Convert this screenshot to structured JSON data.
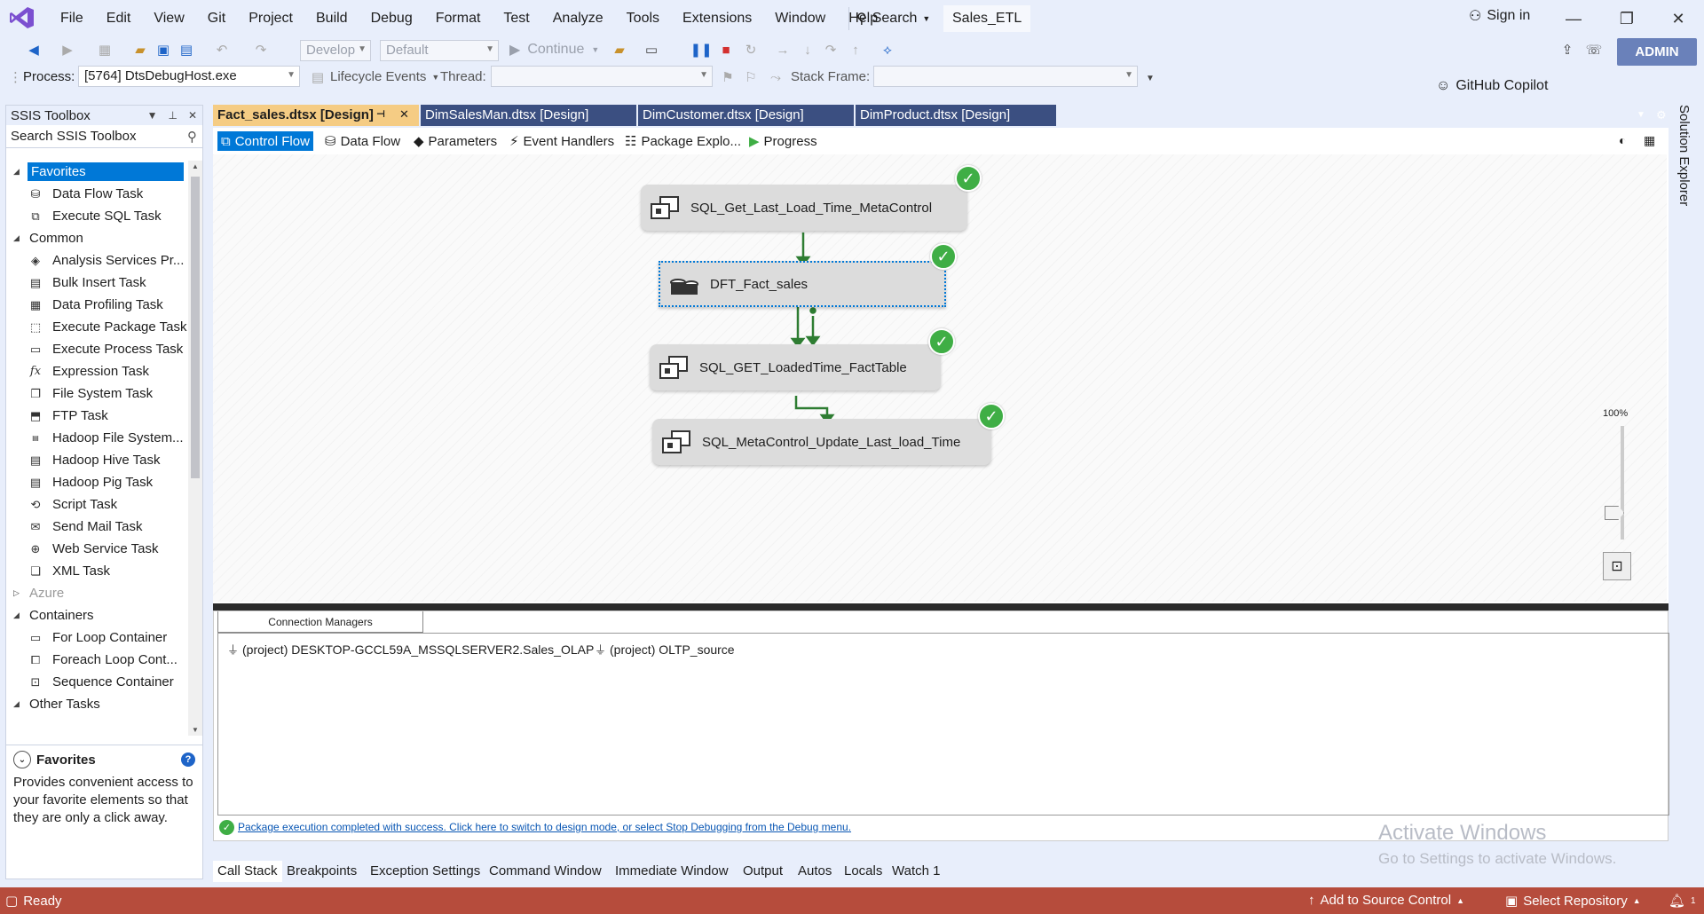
{
  "menubar": {
    "items": [
      "File",
      "Edit",
      "View",
      "Git",
      "Project",
      "Build",
      "Debug",
      "Format",
      "Test",
      "Analyze",
      "Tools",
      "Extensions",
      "Window",
      "Help"
    ],
    "search_label": "Search",
    "solution_name": "Sales_ETL",
    "sign_in": "Sign in"
  },
  "toolbar1": {
    "config_combo": "Develop",
    "platform_combo": "Default",
    "continue_label": "Continue",
    "copilot_label": "GitHub Copilot",
    "admin_label": "ADMIN"
  },
  "toolbar2": {
    "process_label": "Process:",
    "process_value": "[5764] DtsDebugHost.exe",
    "lifecycle_label": "Lifecycle Events",
    "thread_label": "Thread:",
    "stack_frame_label": "Stack Frame:"
  },
  "toolbox": {
    "title": "SSIS Toolbox",
    "search_placeholder": "Search SSIS Toolbox",
    "favorites_label": "Favorites",
    "favorites": [
      "Data Flow Task",
      "Execute SQL Task"
    ],
    "common_label": "Common",
    "common": [
      "Analysis Services Pr...",
      "Bulk Insert Task",
      "Data Profiling Task",
      "Execute Package Task",
      "Execute Process Task",
      "Expression Task",
      "File System Task",
      "FTP Task",
      "Hadoop File System...",
      "Hadoop Hive Task",
      "Hadoop Pig Task",
      "Script Task",
      "Send Mail Task",
      "Web Service Task",
      "XML Task"
    ],
    "azure_label": "Azure",
    "containers_label": "Containers",
    "containers": [
      "For Loop Container",
      "Foreach Loop Cont...",
      "Sequence Container"
    ],
    "other_label": "Other Tasks",
    "desc_title": "Favorites",
    "desc_text": "Provides convenient access to your favorite elements so that they are only a click away."
  },
  "doc_tabs": [
    {
      "label": "Fact_sales.dtsx [Design]",
      "active": true
    },
    {
      "label": "DimSalesMan.dtsx [Design]",
      "active": false
    },
    {
      "label": "DimCustomer.dtsx [Design]",
      "active": false
    },
    {
      "label": "DimProduct.dtsx [Design]",
      "active": false
    }
  ],
  "designer_tabs": [
    "Control Flow",
    "Data Flow",
    "Parameters",
    "Event Handlers",
    "Package Explo...",
    "Progress"
  ],
  "tasks": [
    {
      "name": "SQL_Get_Last_Load_Time_MetaControl",
      "status": "success"
    },
    {
      "name": "DFT_Fact_sales",
      "status": "success"
    },
    {
      "name": "SQL_GET_LoadedTime_FactTable",
      "status": "success"
    },
    {
      "name": "SQL_MetaControl_Update_Last_load_Time",
      "status": "success"
    }
  ],
  "zoom_label": "100%",
  "connection_managers": {
    "tab_label": "Connection Managers",
    "items": [
      "(project) DESKTOP-GCCL59A_MSSQLSERVER2.Sales_OLAP",
      "(project) OLTP_source"
    ]
  },
  "status_message": "Package execution completed with success. Click here to switch to design mode, or select Stop Debugging from the Debug menu.",
  "watermark": {
    "line1": "Activate Windows",
    "line2": "Go to Settings to activate Windows."
  },
  "bottom_tabs": [
    "Call Stack",
    "Breakpoints",
    "Exception Settings",
    "Command Window",
    "Immediate Window",
    "Output",
    "Autos",
    "Locals",
    "Watch 1"
  ],
  "statusbar": {
    "ready": "Ready",
    "add_source_control": "Add to Source Control",
    "select_repository": "Select Repository",
    "notification_count": "1"
  },
  "side_tab": "Solution Explorer",
  "colors": {
    "accent": "#0078d7",
    "statusbar": "#b64c3c",
    "active_tab": "#f5cc84",
    "inactive_tab": "#3b4f81",
    "success": "#3fae45"
  }
}
